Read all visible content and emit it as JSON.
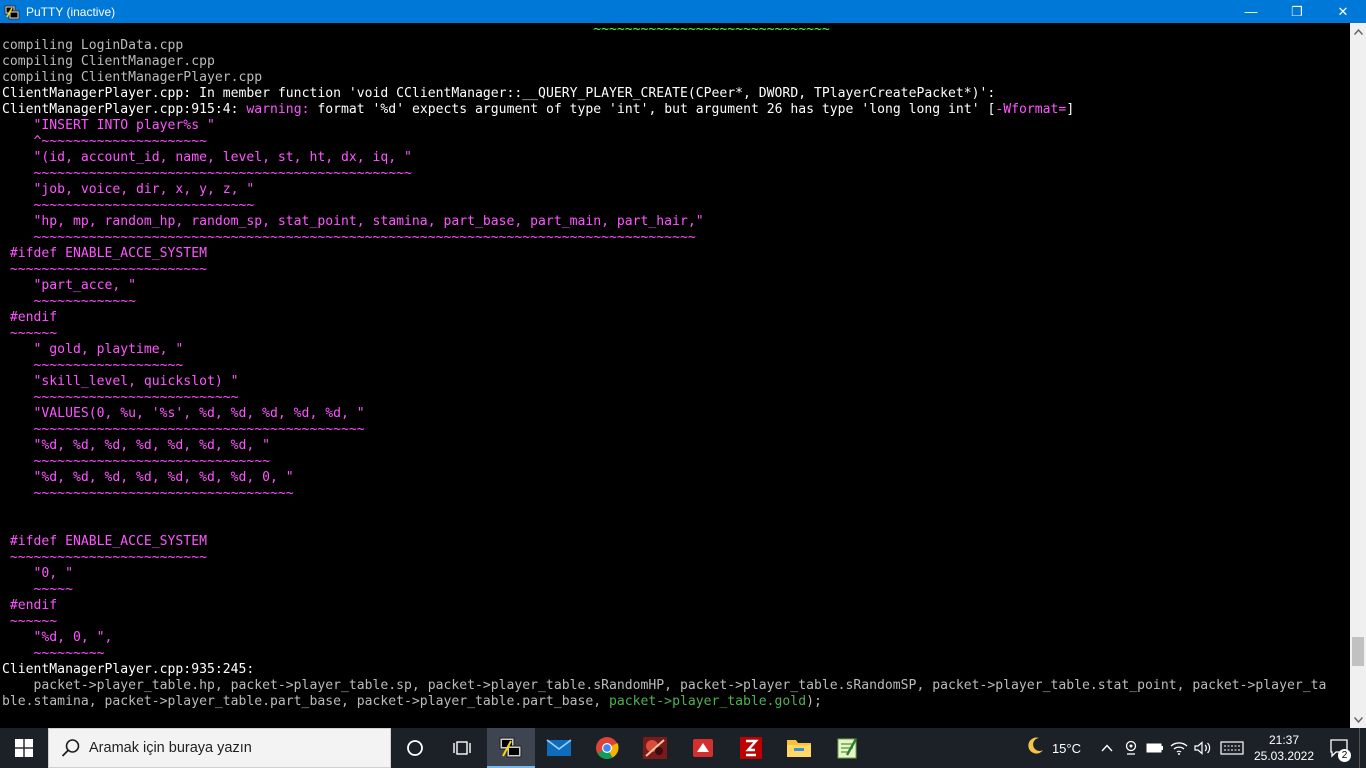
{
  "window": {
    "title": "PuTTY (inactive)",
    "minimize_glyph": "—",
    "maximize_glyph": "❐",
    "close_glyph": "✕"
  },
  "terminal": {
    "lines": [
      [
        {
          "t": "                                                                           ~~~~~~~~~~~~~~~~~~~~~~~~~~~~~~",
          "c": "green"
        }
      ],
      [
        {
          "t": "compiling LoginData.cpp",
          "c": "gray"
        }
      ],
      [
        {
          "t": "compiling ClientManager.cpp",
          "c": "gray"
        }
      ],
      [
        {
          "t": "compiling ClientManagerPlayer.cpp",
          "c": "gray"
        }
      ],
      [
        {
          "t": "ClientManagerPlayer.cpp:",
          "c": "white"
        },
        {
          "t": " In member function 'void CClientManager::__QUERY_PLAYER_CREATE(CPeer*, DWORD, TPlayerCreatePacket*)':",
          "c": "white"
        }
      ],
      [
        {
          "t": "ClientManagerPlayer.cpp:915:4: ",
          "c": "white"
        },
        {
          "t": "warning: ",
          "c": "magenta"
        },
        {
          "t": "format '",
          "c": "white"
        },
        {
          "t": "%d",
          "c": "white"
        },
        {
          "t": "' expects argument of type '",
          "c": "white"
        },
        {
          "t": "int",
          "c": "white"
        },
        {
          "t": "', but argument 26 has type '",
          "c": "white"
        },
        {
          "t": "long long int",
          "c": "white"
        },
        {
          "t": "' [",
          "c": "white"
        },
        {
          "t": "-Wformat=",
          "c": "magenta"
        },
        {
          "t": "]",
          "c": "white"
        }
      ],
      [
        {
          "t": "    \"INSERT INTO player%s \"",
          "c": "magenta"
        }
      ],
      [
        {
          "t": "    ^~~~~~~~~~~~~~~~~~~~~~",
          "c": "magenta"
        }
      ],
      [
        {
          "t": "    \"(id, account_id, name, level, st, ht, dx, iq, \"",
          "c": "magenta"
        }
      ],
      [
        {
          "t": "    ~~~~~~~~~~~~~~~~~~~~~~~~~~~~~~~~~~~~~~~~~~~~~~~~",
          "c": "magenta"
        }
      ],
      [
        {
          "t": "    \"job, voice, dir, x, y, z, \"",
          "c": "magenta"
        }
      ],
      [
        {
          "t": "    ~~~~~~~~~~~~~~~~~~~~~~~~~~~~",
          "c": "magenta"
        }
      ],
      [
        {
          "t": "    \"hp, mp, random_hp, random_sp, stat_point, stamina, part_base, part_main, part_hair,\"",
          "c": "magenta"
        }
      ],
      [
        {
          "t": "    ~~~~~~~~~~~~~~~~~~~~~~~~~~~~~~~~~~~~~~~~~~~~~~~~~~~~~~~~~~~~~~~~~~~~~~~~~~~~~~~~~~~~",
          "c": "magenta"
        }
      ],
      [
        {
          "t": " #ifdef ENABLE_ACCE_SYSTEM",
          "c": "magenta"
        }
      ],
      [
        {
          "t": " ~~~~~~~~~~~~~~~~~~~~~~~~~",
          "c": "magenta"
        }
      ],
      [
        {
          "t": "    \"part_acce, \"",
          "c": "magenta"
        }
      ],
      [
        {
          "t": "    ~~~~~~~~~~~~~",
          "c": "magenta"
        }
      ],
      [
        {
          "t": " #endif",
          "c": "magenta"
        }
      ],
      [
        {
          "t": " ~~~~~~",
          "c": "magenta"
        }
      ],
      [
        {
          "t": "    \" gold, playtime, \"",
          "c": "magenta"
        }
      ],
      [
        {
          "t": "    ~~~~~~~~~~~~~~~~~~~",
          "c": "magenta"
        }
      ],
      [
        {
          "t": "    \"skill_level, quickslot) \"",
          "c": "magenta"
        }
      ],
      [
        {
          "t": "    ~~~~~~~~~~~~~~~~~~~~~~~~~~",
          "c": "magenta"
        }
      ],
      [
        {
          "t": "    \"VALUES(0, %u, '%s', %d, %d, %d, %d, %d, \"",
          "c": "magenta"
        }
      ],
      [
        {
          "t": "    ~~~~~~~~~~~~~~~~~~~~~~~~~~~~~~~~~~~~~~~~~~",
          "c": "magenta"
        }
      ],
      [
        {
          "t": "    \"%d, %d, %d, %d, %d, %d, %d, \"",
          "c": "magenta"
        }
      ],
      [
        {
          "t": "    ~~~~~~~~~~~~~~~~~~~~~~~~~~~~~~",
          "c": "magenta"
        }
      ],
      [
        {
          "t": "    \"%d, %d, %d, %d, %d, %d, %d, 0, \"",
          "c": "magenta"
        }
      ],
      [
        {
          "t": "    ~~~~~~~~~~~~~~~~~~~~~~~~~~~~~~~~~",
          "c": "magenta"
        }
      ],
      [
        {
          "t": "",
          "c": "gray"
        }
      ],
      [
        {
          "t": "",
          "c": "gray"
        }
      ],
      [
        {
          "t": " #ifdef ENABLE_ACCE_SYSTEM",
          "c": "magenta"
        }
      ],
      [
        {
          "t": " ~~~~~~~~~~~~~~~~~~~~~~~~~",
          "c": "magenta"
        }
      ],
      [
        {
          "t": "    \"0, \"",
          "c": "magenta"
        }
      ],
      [
        {
          "t": "    ~~~~~",
          "c": "magenta"
        }
      ],
      [
        {
          "t": " #endif",
          "c": "magenta"
        }
      ],
      [
        {
          "t": " ~~~~~~",
          "c": "magenta"
        }
      ],
      [
        {
          "t": "    \"%d, 0, \",",
          "c": "magenta"
        }
      ],
      [
        {
          "t": "    ~~~~~~~~~",
          "c": "magenta"
        }
      ],
      [
        {
          "t": "ClientManagerPlayer.cpp:935:245:",
          "c": "white"
        }
      ],
      [
        {
          "t": "    packet->player_table.hp, packet->player_table.sp, packet->player_table.sRandomHP, packet->player_table.sRandomSP, packet->player_table.stat_point, packet->player_ta",
          "c": "gray"
        }
      ],
      [
        {
          "t": "ble.stamina, packet->player_table.part_base, packet->player_table.part_base, ",
          "c": "gray"
        },
        {
          "t": "packet->player_table.gold",
          "c": "dkgreen"
        },
        {
          "t": ");",
          "c": "gray"
        }
      ]
    ]
  },
  "scrollbar": {
    "position_fraction": 0.93
  },
  "taskbar": {
    "search_placeholder": "Aramak için buraya yazın",
    "apps": [
      "task-view",
      "widgets",
      "putty",
      "mail",
      "chrome",
      "game",
      "pdf-reader",
      "filezilla",
      "file-explorer",
      "notepad-plus"
    ],
    "weather_temp": "15°C",
    "clock_time": "21:37",
    "clock_date": "25.03.2022",
    "notification_count": "2",
    "colors": {
      "taskbar": "#1c2127",
      "titlebar": "#0078d7"
    }
  }
}
